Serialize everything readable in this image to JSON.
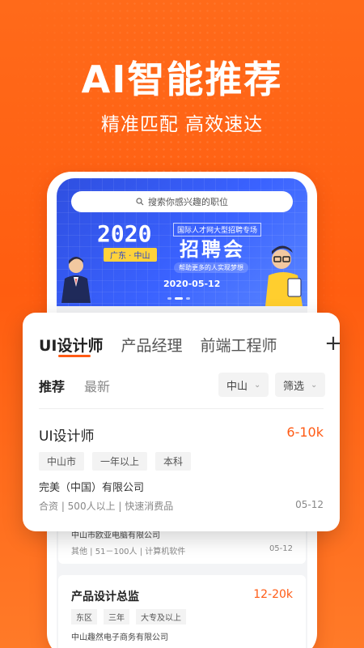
{
  "hero": {
    "title": "AI智能推荐",
    "subtitle": "精准匹配 高效速达"
  },
  "search": {
    "placeholder": "搜索你感兴趣的职位"
  },
  "banner": {
    "year": "2020",
    "place": "广东 · 中山",
    "tag": "国际人才网大型招聘专场",
    "fair": "招聘会",
    "help": "帮助更多的人实现梦想",
    "date": "2020-05-12"
  },
  "tabs": [
    "UI设计师",
    "产品经理",
    "前端工程师"
  ],
  "add_label": "+",
  "subtabs": [
    "推荐",
    "最新"
  ],
  "filters": {
    "city": "中山",
    "filter": "筛选"
  },
  "featured_job": {
    "title": "UI设计师",
    "salary": "6-10k",
    "tags": [
      "中山市",
      "一年以上",
      "本科"
    ],
    "company": "完美（中国）有限公司",
    "meta": "合资 | 500人以上 | 快速消费品",
    "date": "05-12"
  },
  "list": [
    {
      "company": "中山市欧亚电脑有限公司",
      "meta": "其他 | 51－100人 | 计算机软件",
      "date": "05-12"
    },
    {
      "title": "产品设计总监",
      "salary": "12-20k",
      "tags": [
        "东区",
        "三年",
        "大专及以上"
      ],
      "company": "中山趣然电子商务有限公司"
    }
  ],
  "colors": {
    "accent": "#ff5a14",
    "banner": "#3a62ff"
  }
}
